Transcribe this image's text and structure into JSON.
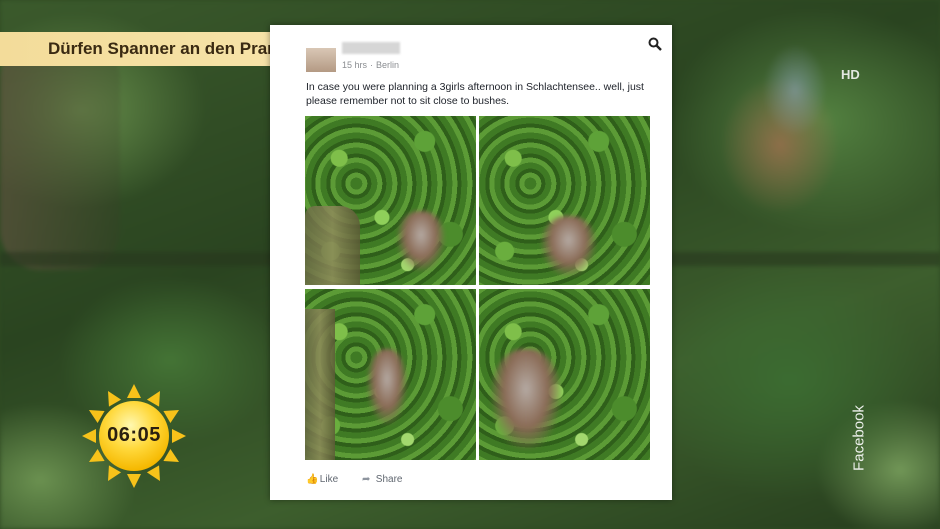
{
  "banner": {
    "headline": "Dürfen Spanner an den Pranger?"
  },
  "channel": {
    "hd_label": "HD",
    "credit": "Facebook"
  },
  "clock": {
    "time": "06:05"
  },
  "post": {
    "time": "15 hrs",
    "location": "Berlin",
    "text": "In case you were planning a 3girls afternoon in Schlachtensee.. well, just please remember not to sit close to bushes.",
    "actions": {
      "like": "Like",
      "share": "Share"
    }
  },
  "icons": [
    "search-icon",
    "like-icon",
    "share-icon",
    "sun-icon"
  ],
  "colors": {
    "banner": "#f3dc9a",
    "sun": "#ffd83a",
    "post_bg": "#ffffff",
    "foliage": "#3c6e22"
  }
}
